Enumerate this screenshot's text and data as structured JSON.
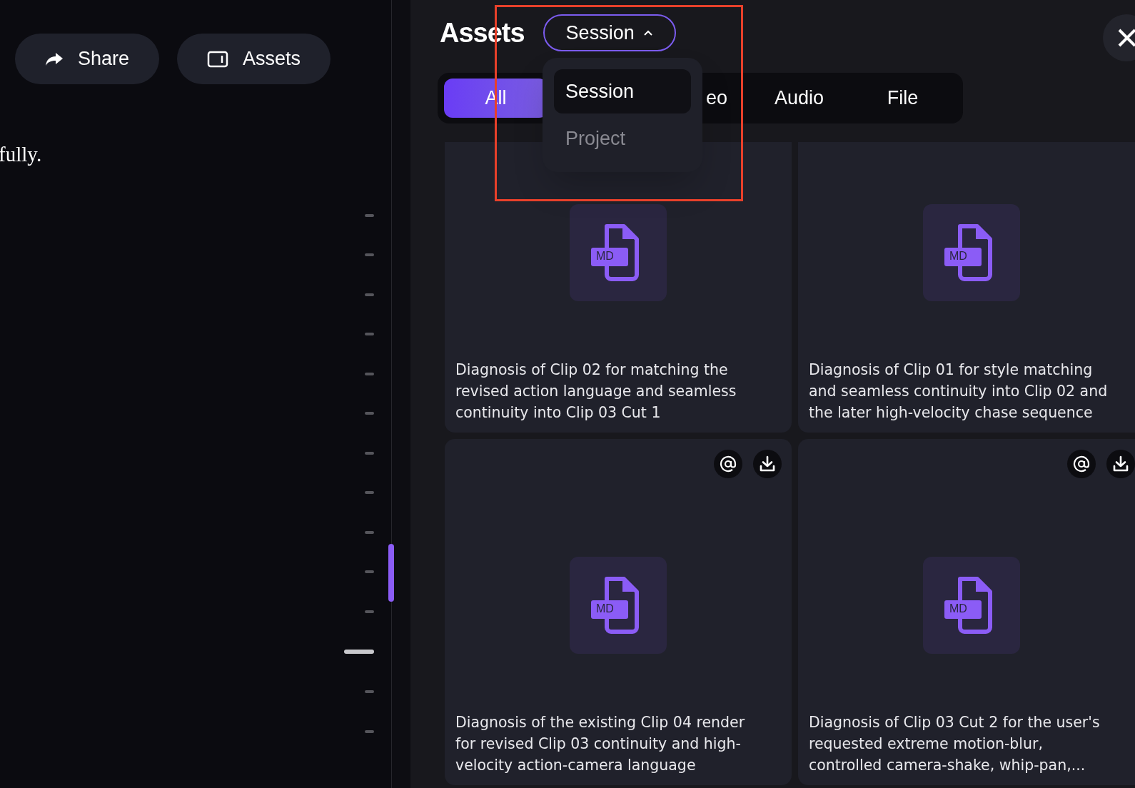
{
  "left_pane": {
    "buttons": [
      {
        "kind": "share",
        "label": "Share"
      },
      {
        "kind": "panel",
        "label": "Assets"
      }
    ],
    "message_fragment": "fully.",
    "timeline_markers": [
      {
        "selected": false
      },
      {
        "selected": false
      },
      {
        "selected": false
      },
      {
        "selected": false
      },
      {
        "selected": false
      },
      {
        "selected": false
      },
      {
        "selected": false
      },
      {
        "selected": false
      },
      {
        "selected": false
      },
      {
        "selected": false
      },
      {
        "selected": false
      },
      {
        "selected": true
      },
      {
        "selected": false
      },
      {
        "selected": false
      }
    ]
  },
  "assets_panel": {
    "title": "Assets",
    "scope_dropdown": {
      "value": "Session",
      "expanded": true,
      "options": [
        {
          "label": "Session",
          "selected": true
        },
        {
          "label": "Project",
          "selected": false
        }
      ]
    },
    "tabs": [
      {
        "label": "All",
        "selected": true
      },
      {
        "label": "eo",
        "selected": false
      },
      {
        "label": "Audio",
        "selected": false
      },
      {
        "label": "File",
        "selected": false
      }
    ],
    "cards": [
      {
        "badge": "MD",
        "title": "Diagnosis of Clip 02 for matching the\nrevised action language and seamless\ncontinuity into Clip 03 Cut 1"
      },
      {
        "badge": "MD",
        "title": "Diagnosis of Clip 01 for style matching\nand seamless continuity into Clip 02 and\nthe later high-velocity chase sequence"
      },
      {
        "badge": "MD",
        "actions": true,
        "title": "Diagnosis of the existing Clip 04 render\nfor revised Clip 03 continuity and high-\nvelocity action-camera language"
      },
      {
        "badge": "MD",
        "actions": true,
        "title": "Diagnosis of Clip 03 Cut 2 for the user's\nrequested extreme motion-blur,\ncontrolled camera-shake, whip-pan,..."
      }
    ]
  }
}
